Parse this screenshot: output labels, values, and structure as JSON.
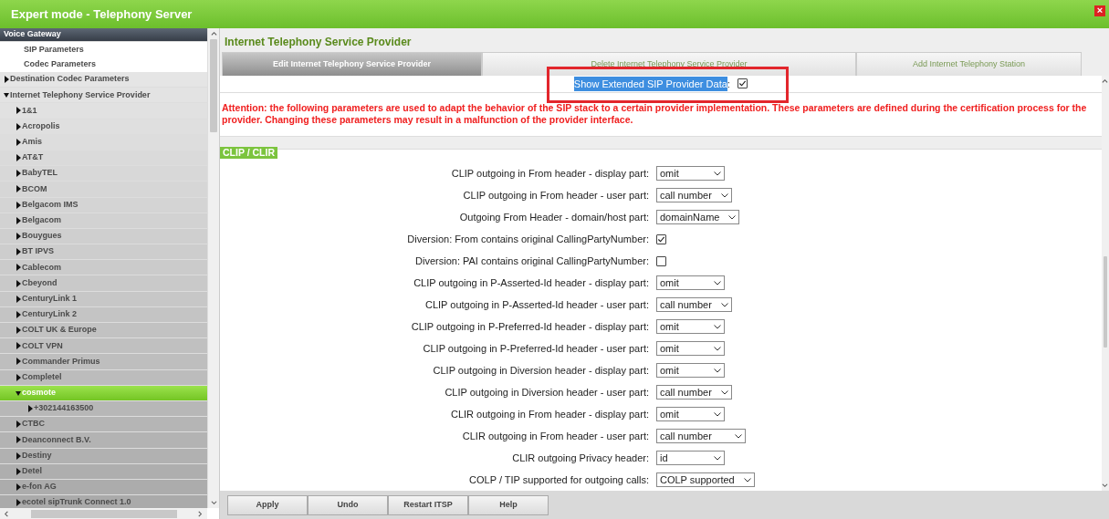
{
  "window": {
    "title": "Expert mode - Telephony Server",
    "close": "×"
  },
  "sidebar": {
    "items": [
      {
        "label": "Voice Gateway",
        "kind": "header",
        "selected": false,
        "children": [
          {
            "label": "SIP Parameters",
            "kind": "page",
            "selected": false
          },
          {
            "label": "Codec Parameters",
            "kind": "page",
            "selected": false
          }
        ]
      },
      {
        "label": "Destination Codec Parameters",
        "kind": "folder",
        "expanded": false,
        "selected": false
      },
      {
        "label": "Internet Telephony Service Provider",
        "kind": "folder",
        "expanded": true,
        "selected": false,
        "children": [
          {
            "label": "1&1",
            "kind": "folder",
            "expanded": false,
            "selected": false
          },
          {
            "label": "Acropolis",
            "kind": "folder",
            "expanded": false,
            "selected": false
          },
          {
            "label": "Amis",
            "kind": "folder",
            "expanded": false,
            "selected": false
          },
          {
            "label": "AT&T",
            "kind": "folder",
            "expanded": false,
            "selected": false
          },
          {
            "label": "BabyTEL",
            "kind": "folder",
            "expanded": false,
            "selected": false
          },
          {
            "label": "BCOM",
            "kind": "folder",
            "expanded": false,
            "selected": false
          },
          {
            "label": "Belgacom IMS",
            "kind": "folder",
            "expanded": false,
            "selected": false
          },
          {
            "label": "Belgacom",
            "kind": "folder",
            "expanded": false,
            "selected": false
          },
          {
            "label": "Bouygues",
            "kind": "folder",
            "expanded": false,
            "selected": false
          },
          {
            "label": "BT IPVS",
            "kind": "folder",
            "expanded": false,
            "selected": false
          },
          {
            "label": "Cablecom",
            "kind": "folder",
            "expanded": false,
            "selected": false
          },
          {
            "label": "Cbeyond",
            "kind": "folder",
            "expanded": false,
            "selected": false
          },
          {
            "label": "CenturyLink 1",
            "kind": "folder",
            "expanded": false,
            "selected": false
          },
          {
            "label": "CenturyLink 2",
            "kind": "folder",
            "expanded": false,
            "selected": false
          },
          {
            "label": "COLT UK & Europe",
            "kind": "folder",
            "expanded": false,
            "selected": false
          },
          {
            "label": "COLT VPN",
            "kind": "folder",
            "expanded": false,
            "selected": false
          },
          {
            "label": "Commander Primus",
            "kind": "folder",
            "expanded": false,
            "selected": false
          },
          {
            "label": "Completel",
            "kind": "folder",
            "expanded": false,
            "selected": false
          },
          {
            "label": "cosmote",
            "kind": "folder",
            "expanded": true,
            "selected": true,
            "children": [
              {
                "label": "+302144163500",
                "kind": "folder",
                "expanded": false,
                "selected": false
              }
            ]
          },
          {
            "label": "CTBC",
            "kind": "folder",
            "expanded": false,
            "selected": false
          },
          {
            "label": "Deanconnect B.V.",
            "kind": "folder",
            "expanded": false,
            "selected": false
          },
          {
            "label": "Destiny",
            "kind": "folder",
            "expanded": false,
            "selected": false
          },
          {
            "label": "Detel",
            "kind": "folder",
            "expanded": false,
            "selected": false
          },
          {
            "label": "e-fon AG",
            "kind": "folder",
            "expanded": false,
            "selected": false
          },
          {
            "label": "ecotel sipTrunk Connect 1.0",
            "kind": "folder",
            "expanded": false,
            "selected": false
          }
        ]
      }
    ]
  },
  "main": {
    "title": "Internet Telephony Service Provider",
    "tabs": [
      {
        "label": "Edit Internet Telephony Service Provider",
        "selected": true
      },
      {
        "label": "Delete Internet Telephony Service Provider",
        "selected": false
      },
      {
        "label": "Add Internet Telephony Station",
        "selected": false
      }
    ],
    "extended_option": {
      "label": "Show Extended SIP Provider Data",
      "separator": ":",
      "checked": true,
      "text_selected": true,
      "highlighted": true
    },
    "attention": "Attention: the following parameters are used to adapt the behavior of the SIP stack to a certain provider implementation.  These parameters are defined during the certification process for the provider.  Changing these parameters may result in a malfunction of the provider interface.",
    "section": "CLIP / CLIR",
    "fields": [
      {
        "label": "CLIP outgoing in From header - display part:",
        "kind": "select",
        "value": "omit"
      },
      {
        "label": "CLIP outgoing in From header - user part:",
        "kind": "select",
        "value": "call number"
      },
      {
        "label": "Outgoing From Header - domain/host part:",
        "kind": "select",
        "value": "domainName"
      },
      {
        "label": "Diversion: From contains original CallingPartyNumber:",
        "kind": "checkbox",
        "checked": true
      },
      {
        "label": "Diversion: PAI contains original CallingPartyNumber:",
        "kind": "checkbox",
        "checked": false
      },
      {
        "label": "CLIP outgoing in P-Asserted-Id header - display part:",
        "kind": "select",
        "value": "omit"
      },
      {
        "label": "CLIP outgoing in P-Asserted-Id header - user part:",
        "kind": "select",
        "value": "call number"
      },
      {
        "label": "CLIP outgoing in P-Preferred-Id header - display part:",
        "kind": "select",
        "value": "omit"
      },
      {
        "label": "CLIP outgoing in P-Preferred-Id header - user part:",
        "kind": "select",
        "value": "omit"
      },
      {
        "label": "CLIP outgoing in Diversion header - display part:",
        "kind": "select",
        "value": "omit"
      },
      {
        "label": "CLIP outgoing in Diversion header - user part:",
        "kind": "select",
        "value": "call number"
      },
      {
        "label": "CLIR outgoing in From header - display part:",
        "kind": "select",
        "value": "omit"
      },
      {
        "label": "CLIR outgoing in From header - user part:",
        "kind": "select",
        "value": "call number",
        "wide": true
      },
      {
        "label": "CLIR outgoing Privacy header:",
        "kind": "select",
        "value": "id"
      },
      {
        "label": "COLP / TIP supported for outgoing calls:",
        "kind": "select",
        "value": "COLP supported"
      }
    ],
    "buttons": [
      "Apply",
      "Undo",
      "Restart ITSP",
      "Help"
    ]
  }
}
